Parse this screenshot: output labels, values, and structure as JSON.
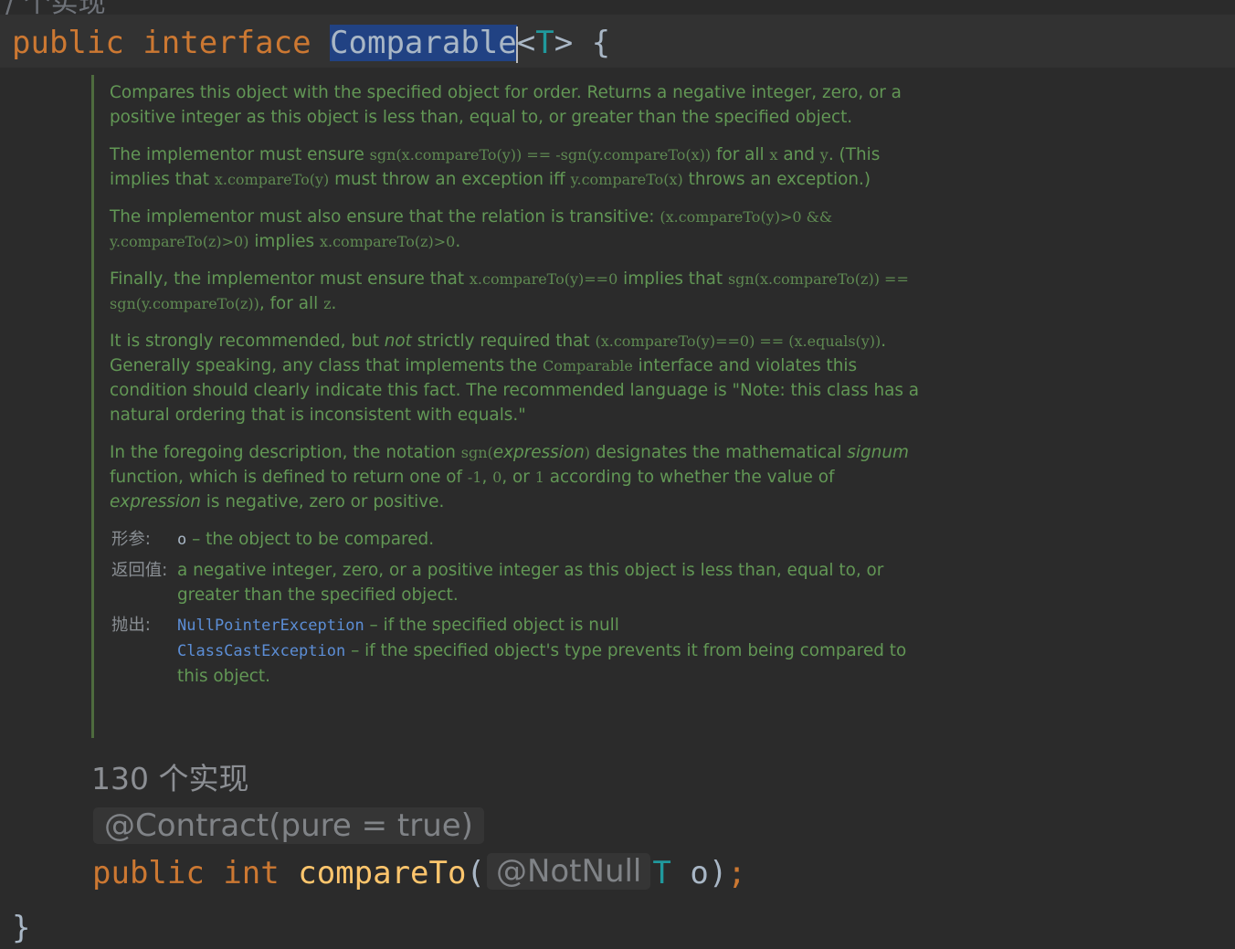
{
  "top_fragment": "/   个实现",
  "declaration": {
    "public_kw": "public",
    "interface_kw": "interface",
    "name": "Comparable",
    "type_param_open": "<",
    "type_param": "T",
    "type_param_close": ">",
    "brace_open": "{"
  },
  "doc": {
    "p1": "Compares this object with the specified object for order. Returns a negative integer, zero, or a positive integer as this object is less than, equal to, or greater than the specified object.",
    "p2": {
      "t1": "The implementor must ensure ",
      "c1": "sgn(x.compareTo(y)) == -sgn(y.compareTo(x))",
      "t2": " for all ",
      "c2": "x",
      "t3": " and ",
      "c3": "y",
      "t4": ". (This implies that ",
      "c4": "x.compareTo(y)",
      "t5": " must throw an exception iff ",
      "c5": "y.compareTo(x)",
      "t6": " throws an exception.)"
    },
    "p3": {
      "t1": "The implementor must also ensure that the relation is transitive: ",
      "c1": "(x.compareTo(y)>0 && y.compareTo(z)>0)",
      "t2": " implies ",
      "c2": "x.compareTo(z)>0",
      "t3": "."
    },
    "p4": {
      "t1": "Finally, the implementor must ensure that ",
      "c1": "x.compareTo(y)==0",
      "t2": " implies that ",
      "c2": "sgn(x.compareTo(z)) == sgn(y.compareTo(z))",
      "t3": ", for all ",
      "c3": "z",
      "t4": "."
    },
    "p5": {
      "t1": "It is strongly recommended, but ",
      "i1": "not",
      "t2": " strictly required that ",
      "c1": "(x.compareTo(y)==0) == (x.equals(y))",
      "t3": ". Generally speaking, any class that implements the ",
      "c2": "Comparable",
      "t4": " interface and violates this condition should clearly indicate this fact. The recommended language is \"Note: this class has a natural ordering that is inconsistent with equals.\""
    },
    "p6": {
      "t1": "In the foregoing description, the notation ",
      "c1": "sgn(",
      "i1": "expression",
      "c2": ")",
      "t2": " designates the mathematical ",
      "i2": "signum",
      "t3": " function, which is defined to return one of ",
      "c3": "-1",
      "t4": ", ",
      "c4": "0",
      "t5": ", or ",
      "c5": "1",
      "t6": " according to whether the value of ",
      "i3": "expression",
      "t7": " is negative, zero or positive."
    },
    "tags": {
      "param_label": "形参:",
      "param_name": "o",
      "param_desc": " – the object to be compared.",
      "return_label": "返回值:",
      "return_desc": "a negative integer, zero, or a positive integer as this object is less than, equal to, or greater than the specified object.",
      "throws_label": "抛出:",
      "ex1": "NullPointerException",
      "ex1_desc": " – if the specified object is null",
      "ex2": "ClassCastException",
      "ex2_desc": " – if the specified object's type prevents it from being compared to this object."
    }
  },
  "implementations": "130 个实现",
  "annotation": "@Contract(pure = true)",
  "method": {
    "public_kw": "public",
    "int_kw": "int",
    "name": "compareTo",
    "paren_open": "(",
    "notnull": "@NotNull",
    "param_type": "T",
    "param_name": "o",
    "paren_close": ")",
    "semicolon": ";"
  },
  "closing_brace": "}"
}
